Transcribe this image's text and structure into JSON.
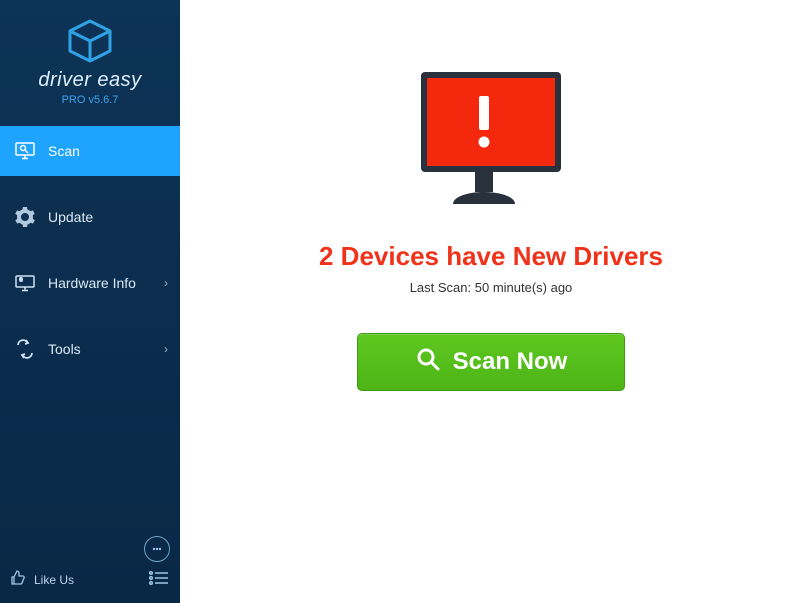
{
  "window": {},
  "branding": {
    "name": "driver easy",
    "version": "PRO v5.6.7"
  },
  "sidebar": {
    "items": [
      {
        "label": "Scan"
      },
      {
        "label": "Update"
      },
      {
        "label": "Hardware Info"
      },
      {
        "label": "Tools"
      }
    ],
    "like_us": "Like Us"
  },
  "main": {
    "headline": "2 Devices have New Drivers",
    "last_scan": "Last Scan: 50 minute(s) ago",
    "scan_button": "Scan Now"
  }
}
